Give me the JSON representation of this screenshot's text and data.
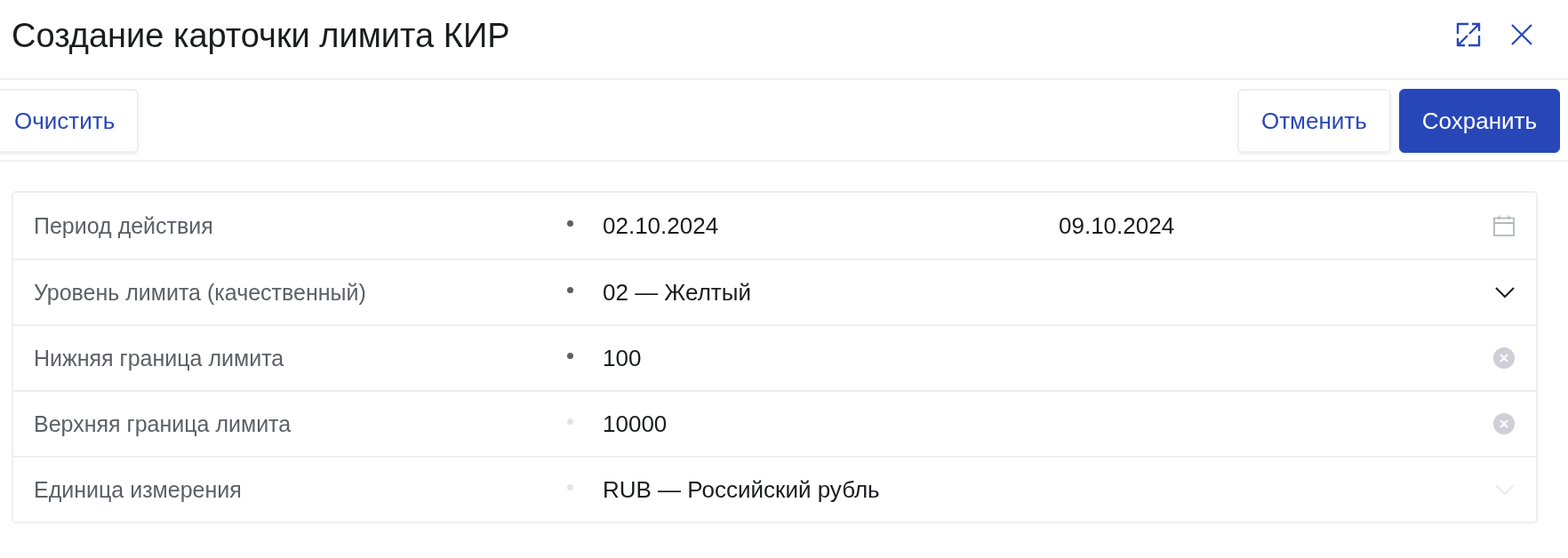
{
  "window": {
    "title": "Создание карточки лимита КИР"
  },
  "toolbar": {
    "left_buttons": [
      {
        "label": "Очистить",
        "kind": "secondary"
      }
    ],
    "right_buttons": [
      {
        "label": "Отменить",
        "kind": "secondary"
      },
      {
        "label": "Сохранить",
        "kind": "primary"
      }
    ]
  },
  "form": {
    "rows": [
      {
        "label": "Период действия",
        "required": true,
        "kind": "date-range",
        "values": [
          "02.10.2024",
          "09.10.2024"
        ],
        "disabled": false
      },
      {
        "label": "Уровень лимита (качественный)",
        "required": true,
        "kind": "select",
        "value": "02 — Желтый",
        "disabled": false
      },
      {
        "label": "Нижняя граница лимита",
        "required": true,
        "kind": "number",
        "value": "100",
        "disabled": false
      },
      {
        "label": "Верхняя граница лимита",
        "required": false,
        "kind": "number",
        "value": "10000",
        "disabled": false
      },
      {
        "label": "Единица измерения",
        "required": false,
        "kind": "select",
        "value": "RUB — Российский рубль",
        "disabled": true
      }
    ]
  }
}
